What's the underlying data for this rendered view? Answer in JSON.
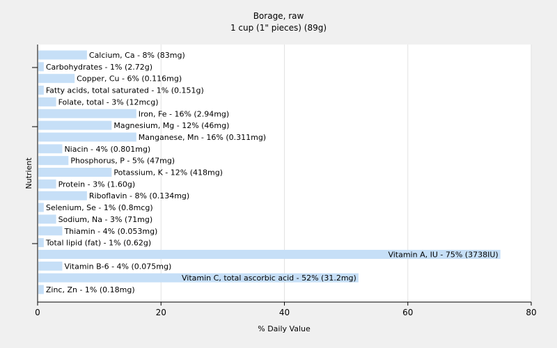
{
  "chart_data": {
    "type": "bar",
    "orientation": "horizontal",
    "title": "Borage, raw",
    "subtitle": "1 cup (1\" pieces) (89g)",
    "xlabel": "% Daily Value",
    "ylabel": "Nutrient",
    "xlim": [
      0,
      80
    ],
    "xticks": [
      0,
      20,
      40,
      60,
      80
    ],
    "grid": true,
    "bar_color": "#c6dff7",
    "categories": [
      "Calcium, Ca",
      "Carbohydrates",
      "Copper, Cu",
      "Fatty acids, total saturated",
      "Folate, total",
      "Iron, Fe",
      "Magnesium, Mg",
      "Manganese, Mn",
      "Niacin",
      "Phosphorus, P",
      "Potassium, K",
      "Protein",
      "Riboflavin",
      "Selenium, Se",
      "Sodium, Na",
      "Thiamin",
      "Total lipid (fat)",
      "Vitamin A, IU",
      "Vitamin B-6",
      "Vitamin C, total ascorbic acid",
      "Zinc, Zn"
    ],
    "values": [
      8,
      1,
      6,
      1,
      3,
      16,
      12,
      16,
      4,
      5,
      12,
      3,
      8,
      1,
      3,
      4,
      1,
      75,
      4,
      52,
      1
    ],
    "labels": [
      "Calcium, Ca - 8% (83mg)",
      "Carbohydrates - 1% (2.72g)",
      "Copper, Cu - 6% (0.116mg)",
      "Fatty acids, total saturated - 1% (0.151g)",
      "Folate, total - 3% (12mcg)",
      "Iron, Fe - 16% (2.94mg)",
      "Magnesium, Mg - 12% (46mg)",
      "Manganese, Mn - 16% (0.311mg)",
      "Niacin - 4% (0.801mg)",
      "Phosphorus, P - 5% (47mg)",
      "Potassium, K - 12% (418mg)",
      "Protein - 3% (1.60g)",
      "Riboflavin - 8% (0.134mg)",
      "Selenium, Se - 1% (0.8mcg)",
      "Sodium, Na - 3% (71mg)",
      "Thiamin - 4% (0.053mg)",
      "Total lipid (fat) - 1% (0.62g)",
      "Vitamin A, IU - 75% (3738IU)",
      "Vitamin B-6 - 4% (0.075mg)",
      "Vitamin C, total ascorbic acid - 52% (31.2mg)",
      "Zinc, Zn - 1% (0.18mg)"
    ]
  }
}
